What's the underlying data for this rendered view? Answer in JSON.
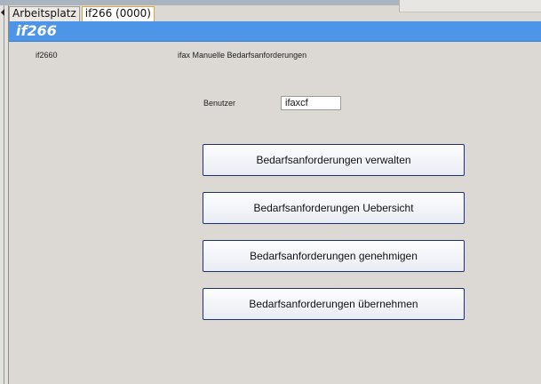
{
  "tabs": [
    {
      "label": "Arbeitsplatz"
    },
    {
      "label": "if266 (0000)"
    }
  ],
  "header": {
    "title": "if266"
  },
  "form": {
    "id_label": "if2660",
    "module_title": "ifax  Manuelle Bedarfsanforderungen",
    "user_label": "Benutzer",
    "user_value": "ifaxcf"
  },
  "actions": [
    {
      "label": "Bedarfsanforderungen verwalten"
    },
    {
      "label": "Bedarfsanforderungen Uebersicht"
    },
    {
      "label": "Bedarfsanforderungen genehmigen"
    },
    {
      "label": "Bedarfsanforderungen übernehmen"
    }
  ]
}
